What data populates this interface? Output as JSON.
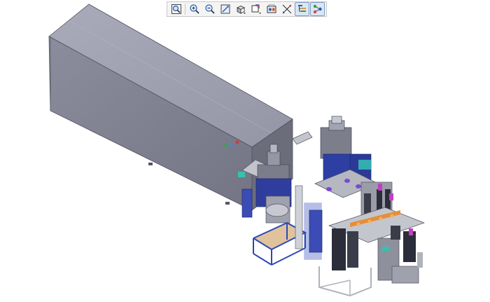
{
  "window": {
    "background": "#ffffff"
  },
  "toolbar": {
    "buttons": [
      {
        "id": "fit-all",
        "icon": "fit-all-icon",
        "state": "normal"
      },
      {
        "id": "zoom-in",
        "icon": "zoom-in-icon",
        "state": "normal"
      },
      {
        "id": "zoom-out",
        "icon": "zoom-out-icon",
        "state": "normal"
      },
      {
        "id": "normal-view",
        "icon": "normal-view-icon",
        "state": "normal"
      },
      {
        "id": "view-orientation",
        "icon": "iso-view-icon",
        "state": "normal"
      },
      {
        "id": "render-style",
        "icon": "render-style-icon",
        "state": "normal"
      },
      {
        "id": "hide-show",
        "icon": "hide-show-icon",
        "state": "normal"
      },
      {
        "id": "swap-visible",
        "icon": "swap-visible-icon",
        "state": "normal"
      },
      {
        "id": "specification-tree",
        "icon": "tree-icon",
        "state": "active"
      },
      {
        "id": "compass",
        "icon": "compass-icon",
        "state": "active"
      }
    ]
  },
  "model": {
    "description_colors": {
      "housing_top": "#9d9eae",
      "housing_front": "#7e8090",
      "housing_side": "#6a6c7a",
      "frame_blue": "#2c47b8",
      "bin_dark": "#2b2d3a",
      "accent_purple": "#6f58c9",
      "panel_grey": "#b4b6be",
      "wood": "#caa37c"
    }
  }
}
